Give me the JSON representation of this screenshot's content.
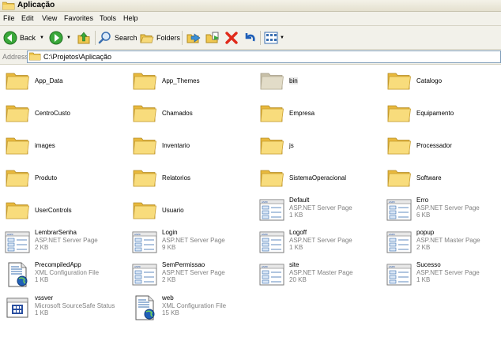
{
  "window": {
    "title": "Aplicação"
  },
  "menu": [
    "File",
    "Edit",
    "View",
    "Favorites",
    "Tools",
    "Help"
  ],
  "toolbar": {
    "back": "Back",
    "search": "Search",
    "folders": "Folders"
  },
  "address": {
    "label": "Address",
    "path": "C:\\Projetos\\Aplicação"
  },
  "items": [
    {
      "name": "App_Data",
      "kind": "folder"
    },
    {
      "name": "App_Themes",
      "kind": "folder"
    },
    {
      "name": "bin",
      "kind": "folder",
      "faded": true
    },
    {
      "name": "Catalogo",
      "kind": "folder"
    },
    {
      "name": "CentroCusto",
      "kind": "folder"
    },
    {
      "name": "Chamados",
      "kind": "folder"
    },
    {
      "name": "Empresa",
      "kind": "folder"
    },
    {
      "name": "Equipamento",
      "kind": "folder"
    },
    {
      "name": "images",
      "kind": "folder"
    },
    {
      "name": "Inventario",
      "kind": "folder"
    },
    {
      "name": "js",
      "kind": "folder"
    },
    {
      "name": "Processador",
      "kind": "folder"
    },
    {
      "name": "Produto",
      "kind": "folder"
    },
    {
      "name": "Relatorios",
      "kind": "folder"
    },
    {
      "name": "SistemaOperacional",
      "kind": "folder"
    },
    {
      "name": "Software",
      "kind": "folder"
    },
    {
      "name": "UserControls",
      "kind": "folder"
    },
    {
      "name": "Usuario",
      "kind": "folder"
    },
    {
      "name": "Default",
      "kind": "aspx",
      "type": "ASP.NET Server Page",
      "size": "1 KB"
    },
    {
      "name": "Erro",
      "kind": "aspx",
      "type": "ASP.NET Server Page",
      "size": "6 KB"
    },
    {
      "name": "LembrarSenha",
      "kind": "aspx",
      "type": "ASP.NET Server Page",
      "size": "2 KB"
    },
    {
      "name": "Login",
      "kind": "aspx",
      "type": "ASP.NET Server Page",
      "size": "9 KB"
    },
    {
      "name": "Logoff",
      "kind": "aspx",
      "type": "ASP.NET Server Page",
      "size": "1 KB"
    },
    {
      "name": "popup",
      "kind": "aspx",
      "type": "ASP.NET Master Page",
      "size": "2 KB"
    },
    {
      "name": "PrecompiledApp",
      "kind": "config",
      "type": "XML Configuration File",
      "size": "1 KB"
    },
    {
      "name": "SemPermissao",
      "kind": "aspx",
      "type": "ASP.NET Server Page",
      "size": "2 KB"
    },
    {
      "name": "site",
      "kind": "aspx",
      "type": "ASP.NET Master Page",
      "size": "20 KB"
    },
    {
      "name": "Sucesso",
      "kind": "aspx",
      "type": "ASP.NET Server Page",
      "size": "1 KB"
    },
    {
      "name": "vssver",
      "kind": "scc",
      "type": "Microsoft SourceSafe Status",
      "size": "1 KB"
    },
    {
      "name": "web",
      "kind": "config",
      "type": "XML Configuration File",
      "size": "15 KB"
    }
  ]
}
